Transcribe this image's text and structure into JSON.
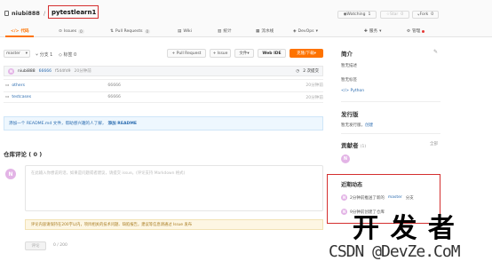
{
  "header": {
    "owner": "niubi888",
    "separator": "/",
    "repo": "pytestlearn1",
    "watch_label": "Watching",
    "watch_count": "1",
    "star_label": "Star",
    "star_count": "0",
    "fork_label": "Fork",
    "fork_count": "0"
  },
  "tabs": [
    {
      "label": "代码",
      "count": ""
    },
    {
      "label": "Issues",
      "count": "0"
    },
    {
      "label": "Pull Requests",
      "count": "0"
    },
    {
      "label": "Wiki",
      "count": ""
    },
    {
      "label": "统计",
      "count": ""
    },
    {
      "label": "流水线",
      "count": ""
    },
    {
      "label": "DevOps",
      "count": ""
    },
    {
      "label": "服务",
      "count": ""
    },
    {
      "label": "管理",
      "count": ""
    }
  ],
  "toolbar": {
    "branch": "master",
    "branches": "分支 1",
    "tags": "标签 0",
    "pull_request": "+ Pull Request",
    "issue": "+ Issue",
    "file": "文件",
    "web_ide": "Web IDE",
    "clone": "克隆/下载"
  },
  "commit": {
    "author": "niubi888",
    "message": "66666",
    "hash": "f544fd9",
    "time": "20分钟前",
    "count": "2 次提交"
  },
  "files": [
    {
      "name": "others",
      "message": "66666",
      "time": "20分钟前"
    },
    {
      "name": "testcases",
      "message": "66666",
      "time": "20分钟前"
    }
  ],
  "readme": {
    "text": "添加一个 README.md 文件，帮助感兴趣的人了解，",
    "link": "添加 README"
  },
  "comments": {
    "title": "仓库评论 ( 0 )",
    "placeholder": "在此输入你想说的话，如果是问题或者建议，请提交 issue。(评论支持 Markdown 格式)",
    "notice": "评论内容请保持在200字以内，项目相关的技术问题、缺陷报告，建议等信息请通过 Issue 发布",
    "submit": "评论",
    "counter": "0 / 200"
  },
  "sidebar": {
    "intro_title": "简介",
    "no_desc": "暂无描述",
    "no_tags": "暂无标签",
    "language": "Python",
    "release_title": "发行版",
    "no_release": "暂无发行版，",
    "create": "创建",
    "contributors_title": "贡献者",
    "contributors_count": "(1)",
    "all": "全部",
    "activity_title": "近期动态",
    "activity": [
      {
        "pre": "2分钟前推送了新的 ",
        "link": "master",
        "post": " 分支"
      },
      {
        "pre": "9分钟前创建了仓库",
        "link": "",
        "post": ""
      }
    ]
  },
  "watermark": {
    "large": "开 发 者",
    "small": "CSDN @DevZe.CoM"
  },
  "colors": {
    "accent": "#fe7300",
    "highlight": "#d42f2f",
    "avatar": "#e3b4e6"
  }
}
